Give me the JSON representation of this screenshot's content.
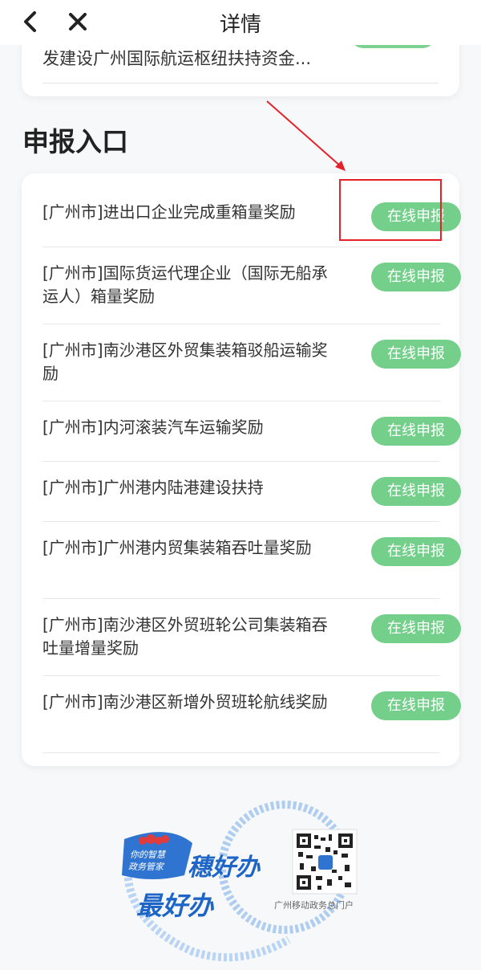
{
  "header": {
    "title": "详情",
    "back_icon": "chevron-left-icon",
    "close_icon": "close-icon"
  },
  "previous_item": {
    "text": "发建设广州国际航运枢纽扶持资金..."
  },
  "section": {
    "title": "申报入口"
  },
  "items": [
    {
      "label": "[广州市]进出口企业完成重箱量奖励",
      "button": "在线申报"
    },
    {
      "label": "[广州市]国际货运代理企业（国际无船承运人）箱量奖励",
      "button": "在线申报"
    },
    {
      "label": "[广州市]南沙港区外贸集装箱驳船运输奖励",
      "button": "在线申报"
    },
    {
      "label": "[广州市]内河滚装汽车运输奖励",
      "button": "在线申报"
    },
    {
      "label": "[广州市]广州港内陆港建设扶持",
      "button": "在线申报"
    },
    {
      "label": "[广州市]广州港内贸集装箱吞吐量奖励",
      "button": "在线申报"
    },
    {
      "label": "[广州市]南沙港区外贸班轮公司集装箱吞吐量增量奖励",
      "button": "在线申报"
    },
    {
      "label": "[广州市]南沙港区新增外贸班轮航线奖励",
      "button": "在线申报"
    }
  ],
  "promo": {
    "slogan_line1": "你的智慧",
    "slogan_line2": "政务管家",
    "brand_line1": "穗好办",
    "brand_line2": "最好办",
    "qr_caption": "广州移动政务总门户"
  },
  "colors": {
    "button_green": "#74cf8b",
    "annotation_red": "#e5212a",
    "brand_blue": "#1d65c6"
  }
}
